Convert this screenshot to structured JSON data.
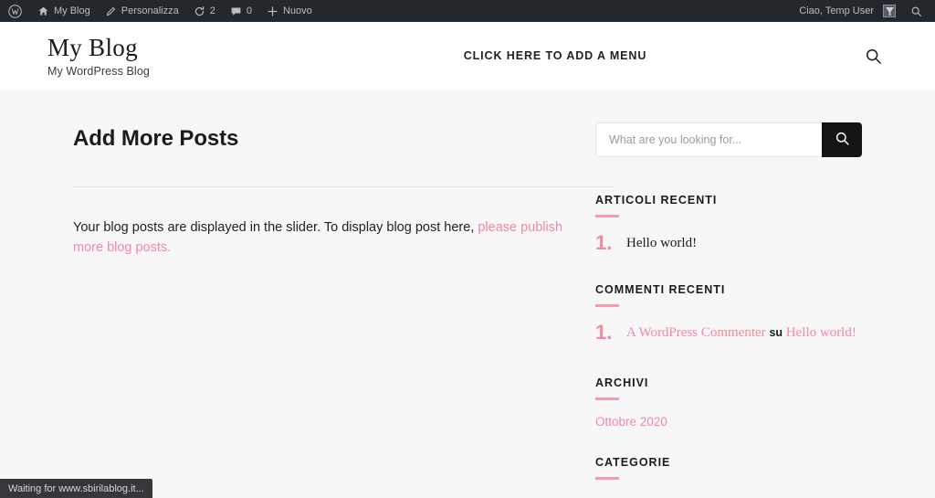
{
  "adminbar": {
    "wp_logo_label": "W",
    "items": [
      {
        "name": "site-name",
        "icon": "home-icon",
        "label": "My Blog"
      },
      {
        "name": "customize",
        "icon": "pencil-icon",
        "label": "Personalizza"
      },
      {
        "name": "updates",
        "icon": "updates-icon",
        "label": "2"
      },
      {
        "name": "comments",
        "icon": "comment-bubble-icon",
        "label": "0"
      },
      {
        "name": "new-content",
        "icon": "plus-icon",
        "label": "Nuovo"
      }
    ],
    "greeting": "Ciao, Temp User",
    "search_icon": "search-icon"
  },
  "header": {
    "site_title": "My Blog",
    "tagline": "My WordPress Blog",
    "menu_prompt": "CLICK HERE TO ADD A MENU",
    "search_icon": "search-icon"
  },
  "main": {
    "page_title": "Add More Posts",
    "body_text_before": "Your blog posts are displayed in the slider. To display blog post here,",
    "body_link": "please publish more blog posts."
  },
  "sidebar": {
    "search": {
      "placeholder": "What are you looking for...",
      "value": "",
      "submit_icon": "search-icon"
    },
    "widgets": [
      {
        "title": "ARTICOLI RECENTI",
        "type": "numbered",
        "items": [
          {
            "marker": "1.",
            "text": "Hello world!",
            "link": false
          }
        ]
      },
      {
        "title": "COMMENTI RECENTI",
        "type": "comment",
        "items": [
          {
            "marker": "1.",
            "author": "A WordPress Commenter",
            "connector": "su",
            "post": "Hello world!"
          }
        ]
      },
      {
        "title": "ARCHIVI",
        "type": "links",
        "items": [
          {
            "label": "Ottobre 2020"
          }
        ]
      },
      {
        "title": "CATEGORIE",
        "type": "links",
        "items": []
      }
    ]
  },
  "statusbar": {
    "text": "Waiting for www.sbirilablog.it..."
  },
  "colors": {
    "accent_pink": "#f5899f",
    "accent_rule": "#f79aae",
    "adminbar_bg": "#23282d",
    "page_bg": "#f7f7f7",
    "ink": "#1b1b1b"
  }
}
